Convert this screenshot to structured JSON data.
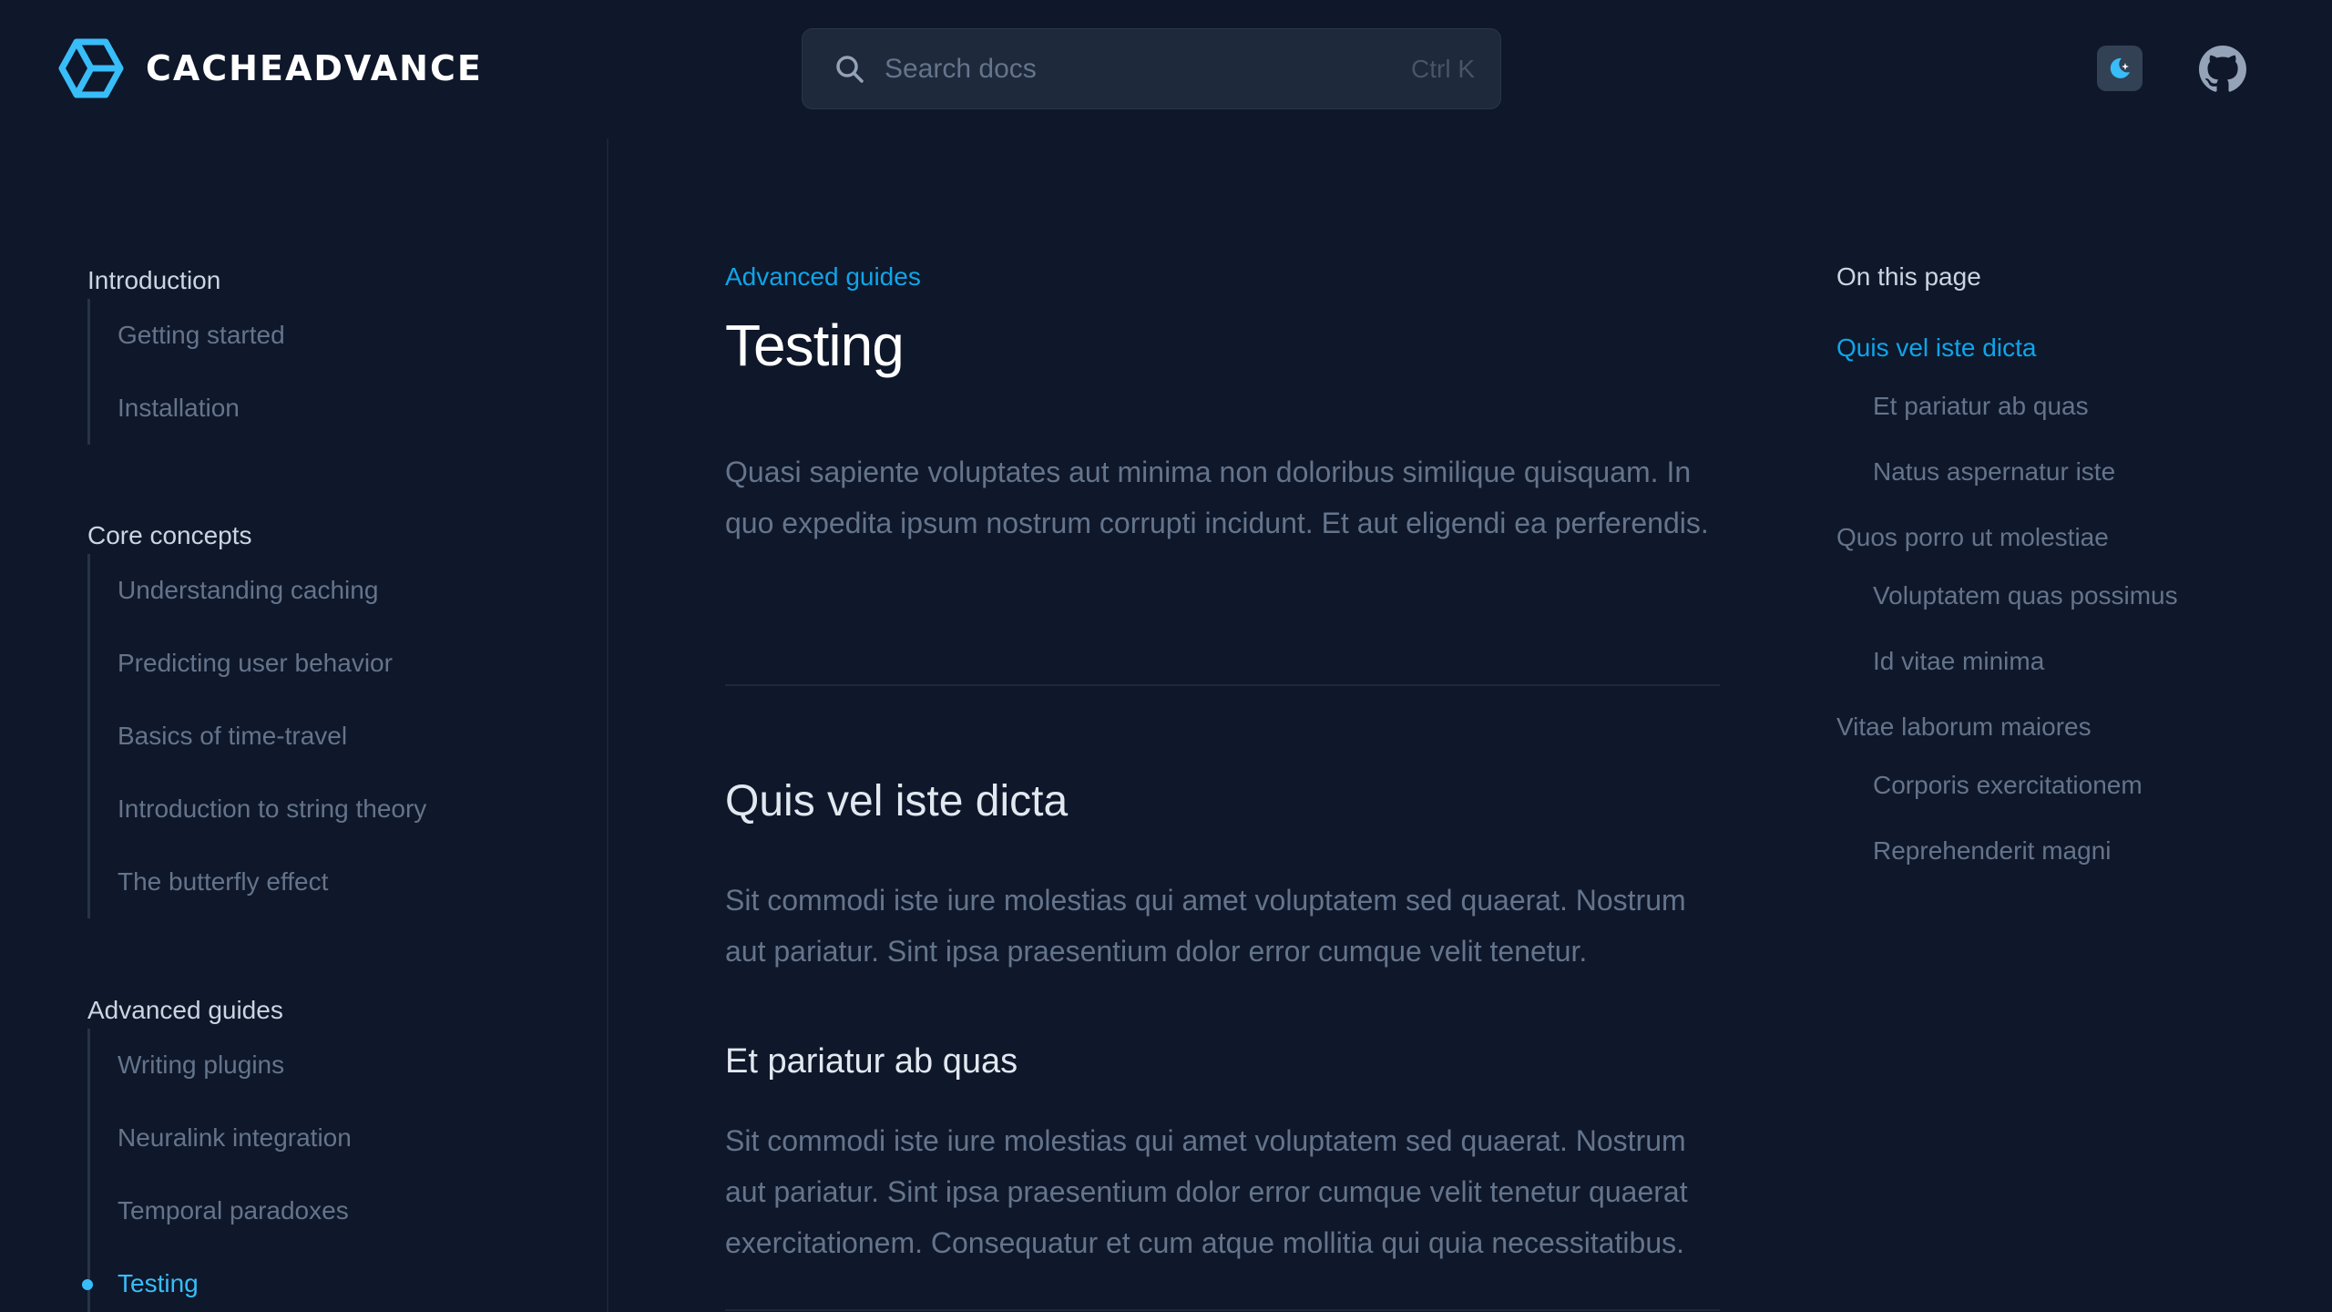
{
  "brand": {
    "name": "CACHEADVANCE",
    "accent": "#38bdf8",
    "background": "#0f172a"
  },
  "search": {
    "placeholder": "Search docs",
    "shortcut": "Ctrl K",
    "icon": "search-icon"
  },
  "header_icons": {
    "theme": "moon-icon",
    "repo": "github-icon"
  },
  "sidebar": {
    "sections": [
      {
        "title": "Introduction",
        "items": [
          "Getting started",
          "Installation"
        ]
      },
      {
        "title": "Core concepts",
        "items": [
          "Understanding caching",
          "Predicting user behavior",
          "Basics of time-travel",
          "Introduction to string theory",
          "The butterfly effect"
        ]
      },
      {
        "title": "Advanced guides",
        "items": [
          "Writing plugins",
          "Neuralink integration",
          "Temporal paradoxes",
          "Testing"
        ],
        "active_item": "Testing"
      }
    ]
  },
  "main": {
    "eyebrow": "Advanced guides",
    "title": "Testing",
    "lead": "Quasi sapiente voluptates aut minima non doloribus similique quisquam. In quo expedita ipsum nostrum corrupti incidunt. Et aut eligendi ea perferendis.",
    "section1": {
      "heading": "Quis vel iste dicta",
      "body": "Sit commodi iste iure molestias qui amet voluptatem sed quaerat. Nostrum aut pariatur. Sint ipsa praesentium dolor error cumque velit tenetur."
    },
    "section2": {
      "heading": "Et pariatur ab quas",
      "body": "Sit commodi iste iure molestias qui amet voluptatem sed quaerat. Nostrum aut pariatur. Sint ipsa praesentium dolor error cumque velit tenetur quaerat exercitationem. Consequatur et cum atque mollitia qui quia necessitatibus."
    }
  },
  "toc": {
    "title": "On this page",
    "items": [
      {
        "label": "Quis vel iste dicta",
        "level": 1,
        "active": true
      },
      {
        "label": "Et pariatur ab quas",
        "level": 2
      },
      {
        "label": "Natus aspernatur iste",
        "level": 2
      },
      {
        "label": "Quos porro ut molestiae",
        "level": 1
      },
      {
        "label": "Voluptatem quas possimus",
        "level": 2
      },
      {
        "label": "Id vitae minima",
        "level": 2
      },
      {
        "label": "Vitae laborum maiores",
        "level": 1
      },
      {
        "label": "Corporis exercitationem",
        "level": 2
      },
      {
        "label": "Reprehenderit magni",
        "level": 2
      }
    ]
  }
}
